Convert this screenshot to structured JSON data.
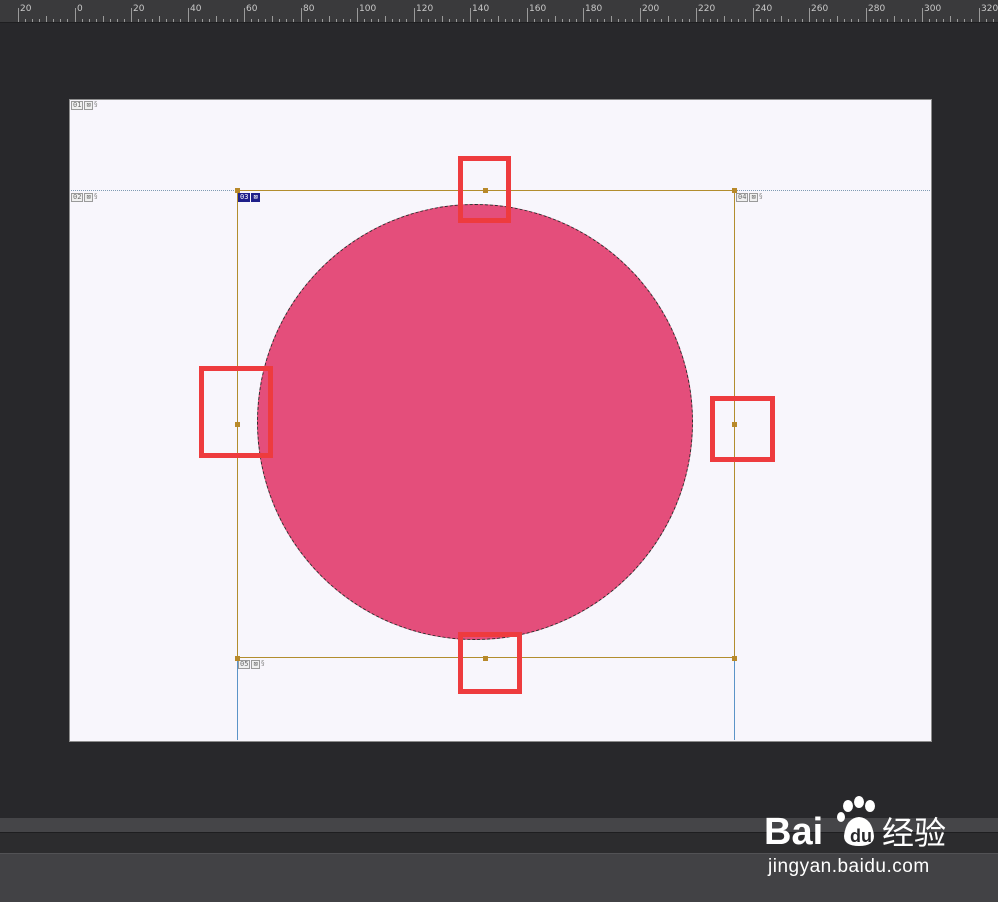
{
  "ruler": {
    "labels": [
      "20",
      "0",
      "20",
      "40",
      "60",
      "80",
      "100",
      "120",
      "140",
      "160",
      "180",
      "200",
      "220",
      "240",
      "260",
      "280",
      "300",
      "320"
    ]
  },
  "slices": [
    {
      "number": "01",
      "active": false
    },
    {
      "number": "02",
      "active": false
    },
    {
      "number": "03",
      "active": true
    },
    {
      "number": "04",
      "active": false
    },
    {
      "number": "05",
      "active": false
    }
  ],
  "colors": {
    "workspace_bg": "#28282b",
    "canvas_bg": "#f8f6fc",
    "circle_fill": "#e44e7b",
    "bounding_box": "#b28d2e",
    "highlight": "#ee3b3e",
    "guide": "#5b94c8"
  },
  "watermark": {
    "logo_text": "Bai du 经验",
    "url": "jingyan.baidu.com"
  }
}
